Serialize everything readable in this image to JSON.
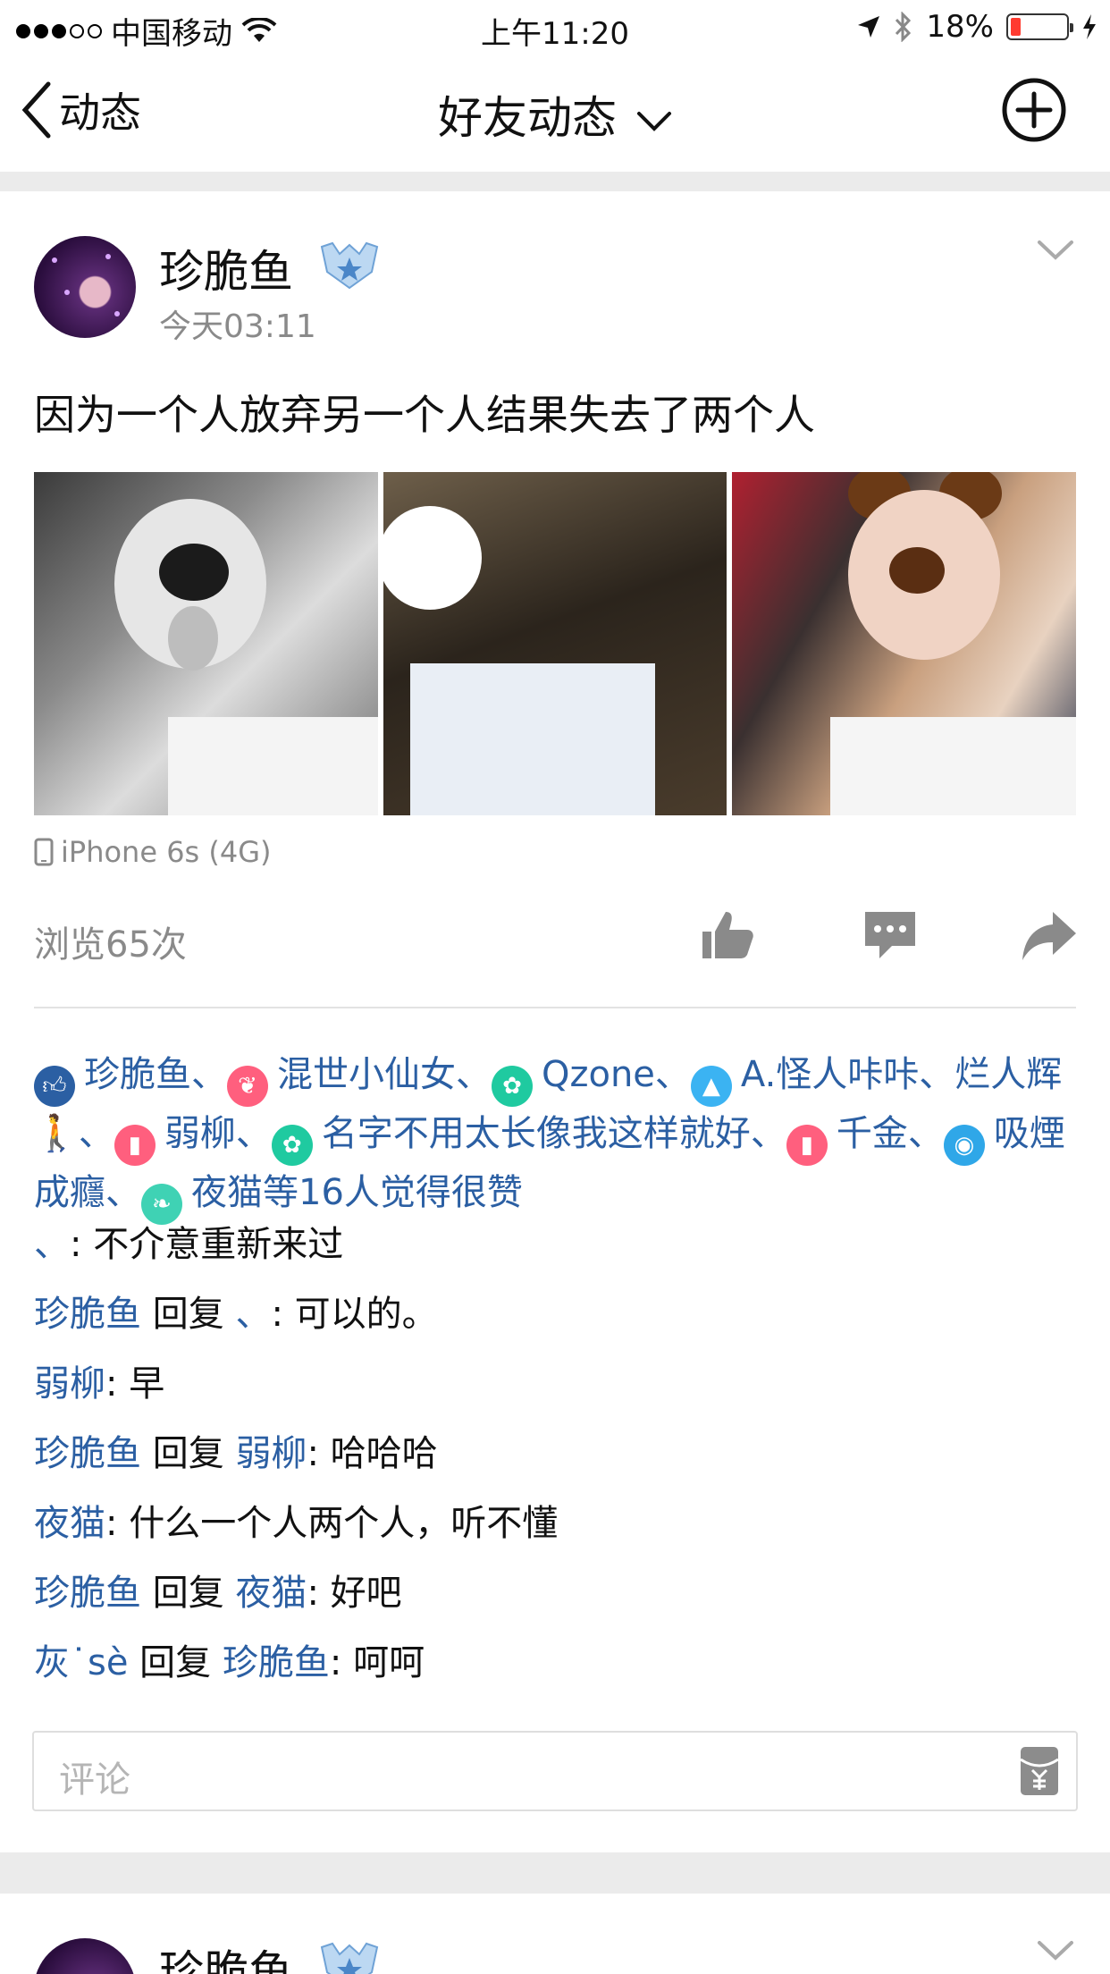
{
  "status_bar": {
    "carrier": "中国移动",
    "time": "上午11:20",
    "battery_percent": "18%",
    "battery_level": 0.18
  },
  "nav": {
    "back_label": "动态",
    "title": "好友动态"
  },
  "post": {
    "author": "珍脆鱼",
    "time": "今天03:11",
    "text": "因为一个人放弃另一个人结果失去了两个人",
    "device": "iPhone 6s (4G)",
    "views": "浏览65次",
    "likes": [
      {
        "name": "珍脆鱼",
        "icon": "thumbs-up-icon",
        "color": "#2b5fa3"
      },
      {
        "name": "混世小仙女",
        "icon": "wings-icon",
        "color": "#ff5f7e"
      },
      {
        "name": "Qzone",
        "icon": "qzone-icon",
        "color": "#1fcaa0"
      },
      {
        "name": "A.怪人咔咔",
        "icon": "rocket-icon",
        "color": "#3bb3f2"
      },
      {
        "name": "烂人辉🚶",
        "icon": "",
        "color": ""
      },
      {
        "name": "弱柳",
        "icon": "lipstick-icon",
        "color": "#ff5f7e"
      },
      {
        "name": "名字不用太长像我这样就好",
        "icon": "qzone-icon",
        "color": "#1fcaa0"
      },
      {
        "name": "千金",
        "icon": "lipstick-icon",
        "color": "#ff5f7e"
      },
      {
        "name": "吸煙成癮",
        "icon": "ring-icon",
        "color": "#2fa7e8"
      },
      {
        "name": "夜猫",
        "icon": "leaf-icon",
        "color": "#3fd2b4"
      }
    ],
    "likes_suffix": "等16人觉得很赞",
    "like_separator": "、",
    "reply_word": "回复",
    "comments": [
      {
        "name": "、",
        "reply_to": "",
        "text": ": 不介意重新来过"
      },
      {
        "name": "珍脆鱼",
        "reply_to": "、",
        "text": ": 可以的。"
      },
      {
        "name": "弱柳",
        "reply_to": "",
        "text": ": 早"
      },
      {
        "name": "珍脆鱼",
        "reply_to": "弱柳",
        "text": ": 哈哈哈"
      },
      {
        "name": "夜猫",
        "reply_to": "",
        "text": ": 什么一个人两个人，听不懂"
      },
      {
        "name": "珍脆鱼",
        "reply_to": "夜猫",
        "text": ": 好吧"
      },
      {
        "name": "灰˙sè",
        "reply_to": "珍脆鱼",
        "text": ": 呵呵"
      }
    ],
    "comment_placeholder": "评论"
  },
  "next_post": {
    "author": "珍脆鱼"
  },
  "colors": {
    "link_blue": "#2b5fa3",
    "muted_gray": "#8a8a8a",
    "band_gray": "#ebebeb"
  }
}
